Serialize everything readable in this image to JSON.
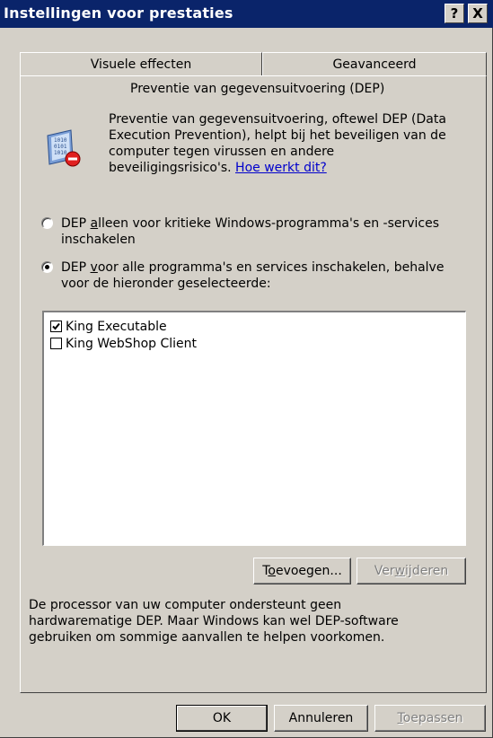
{
  "window": {
    "title": "Instellingen voor prestaties",
    "help_button": "?",
    "close_button": "X"
  },
  "tabs": [
    {
      "label": "Visuele effecten"
    },
    {
      "label": "Geavanceerd"
    }
  ],
  "panel": {
    "heading": "Preventie van gegevensuitvoering (DEP)",
    "description": {
      "line1": "Preventie van gegevensuitvoering, oftewel DEP (Data",
      "line2": "Execution Prevention), helpt bij het beveiligen van de",
      "line3": "computer tegen virussen en andere",
      "line4": "beveiligingsrisico's.",
      "link": "Hoe werkt dit?"
    },
    "options": [
      {
        "line1_pre": "DEP ",
        "line1_mnemonic": "a",
        "line1_post": "lleen voor kritieke Windows-programma's en -services",
        "line2": "inschakelen",
        "selected": false
      },
      {
        "line1_pre": "DEP ",
        "line1_mnemonic": "v",
        "line1_post": "oor alle programma's en services inschakelen, behalve",
        "line2": "voor de hieronder geselecteerde:",
        "selected": true
      }
    ],
    "programs": [
      {
        "name": "King Executable",
        "checked": true
      },
      {
        "name": "King WebShop Client",
        "checked": false
      }
    ],
    "buttons": {
      "add_pre": "T",
      "add_mnemonic": "o",
      "add_post": "evoegen...",
      "remove_pre": "Ver",
      "remove_mnemonic": "w",
      "remove_post": "ijderen"
    },
    "footer": {
      "line1": "De processor van uw computer ondersteunt geen",
      "line2": "hardwarematige DEP. Maar Windows kan wel DEP-software",
      "line3": "gebruiken om sommige aanvallen te helpen voorkomen."
    }
  },
  "dialog_buttons": {
    "ok": "OK",
    "cancel": "Annuleren",
    "apply_mnemonic": "T",
    "apply_post": "oepassen"
  }
}
